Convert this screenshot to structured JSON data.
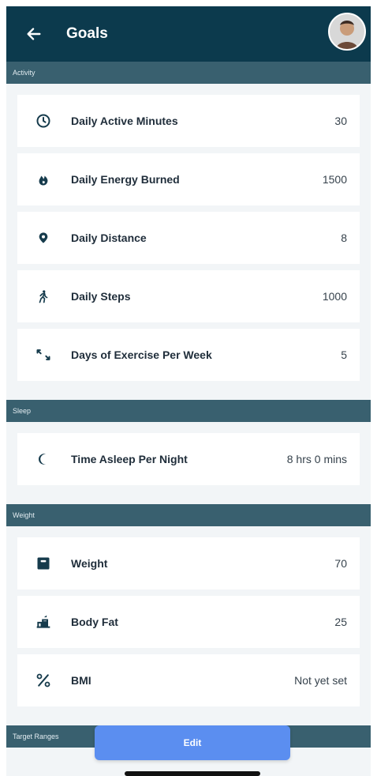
{
  "header": {
    "title": "Goals"
  },
  "sections": {
    "activity": {
      "title": "Activity",
      "rows": [
        {
          "label": "Daily Active Minutes",
          "value": "30",
          "icon": "clock-icon"
        },
        {
          "label": "Daily Energy Burned",
          "value": "1500",
          "icon": "flame-icon"
        },
        {
          "label": "Daily Distance",
          "value": "8",
          "icon": "location-pin-icon"
        },
        {
          "label": "Daily Steps",
          "value": "1000",
          "icon": "walking-icon"
        },
        {
          "label": "Days of Exercise Per Week",
          "value": "5",
          "icon": "arrows-icon"
        }
      ]
    },
    "sleep": {
      "title": "Sleep",
      "rows": [
        {
          "label": "Time Asleep Per Night",
          "value": "8 hrs 0 mins",
          "icon": "moon-icon"
        }
      ]
    },
    "weight": {
      "title": "Weight",
      "rows": [
        {
          "label": "Weight",
          "value": "70",
          "icon": "scale-icon"
        },
        {
          "label": "Body Fat",
          "value": "25",
          "icon": "body-fat-icon"
        },
        {
          "label": "BMI",
          "value": "Not yet set",
          "icon": "percent-icon"
        }
      ]
    },
    "target": {
      "title": "Target Ranges"
    }
  },
  "footer": {
    "edit_label": "Edit"
  },
  "colors": {
    "header": "#0c3a4d",
    "section": "#39606f",
    "button": "#5b8ef0"
  }
}
